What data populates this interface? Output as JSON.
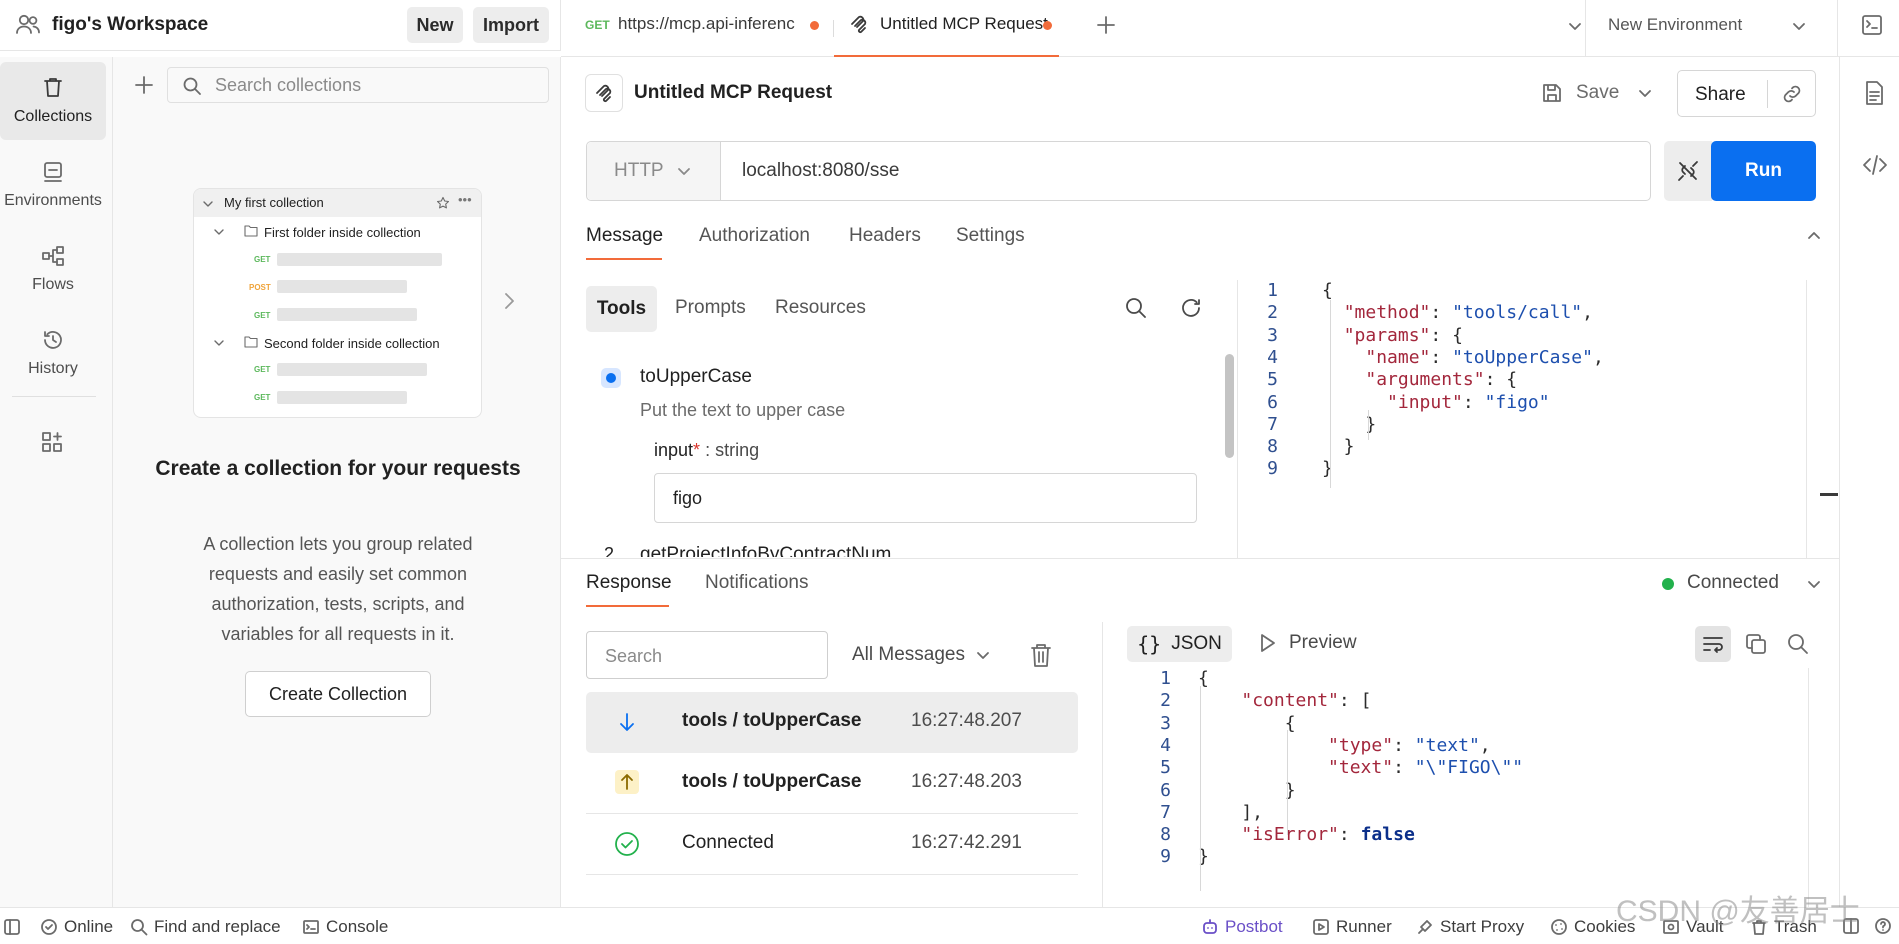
{
  "workspace": {
    "name": "figo's Workspace",
    "new_label": "New",
    "import_label": "Import"
  },
  "tabs": [
    {
      "method": "GET",
      "label": "https://mcp.api-inferenc"
    },
    {
      "label": "Untitled MCP Request"
    }
  ],
  "environment": {
    "selected": "New Environment"
  },
  "nav": {
    "items": [
      {
        "label": "Collections"
      },
      {
        "label": "Environments"
      },
      {
        "label": "Flows"
      },
      {
        "label": "History"
      }
    ]
  },
  "collections": {
    "search_placeholder": "Search collections",
    "preview": {
      "collection_name": "My first collection",
      "folder1": "First folder inside collection",
      "folder2": "Second folder inside collection",
      "methods": [
        "GET",
        "POST",
        "GET",
        "GET",
        "GET"
      ]
    },
    "empty_title": "Create a collection for your requests",
    "empty_desc": "A collection lets you group related requests and easily set common authorization, tests, scripts, and variables for all requests in it.",
    "create_button": "Create Collection"
  },
  "request": {
    "title": "Untitled MCP Request",
    "save_label": "Save",
    "share_label": "Share",
    "transport": "HTTP",
    "url": "localhost:8080/sse",
    "run_label": "Run",
    "tabs": [
      "Message",
      "Authorization",
      "Headers",
      "Settings"
    ],
    "tool_tabs": [
      "Tools",
      "Prompts",
      "Resources"
    ],
    "tools": [
      {
        "name": "toUpperCase",
        "description": "Put the text to upper case",
        "param_name": "input",
        "param_required": "*",
        "param_type": ": string",
        "param_value": "figo"
      },
      {
        "index": "2",
        "name": "getProjectInfoByContractNum"
      }
    ],
    "message_code": [
      {
        "n": "1",
        "segs": [
          {
            "t": "{",
            "c": "p"
          }
        ]
      },
      {
        "n": "2",
        "segs": [
          {
            "t": "  ",
            "c": "p"
          },
          {
            "t": "\"method\"",
            "c": "k"
          },
          {
            "t": ": ",
            "c": "p"
          },
          {
            "t": "\"tools/call\"",
            "c": "s"
          },
          {
            "t": ",",
            "c": "p"
          }
        ]
      },
      {
        "n": "3",
        "segs": [
          {
            "t": "  ",
            "c": "p"
          },
          {
            "t": "\"params\"",
            "c": "k"
          },
          {
            "t": ": {",
            "c": "p"
          }
        ]
      },
      {
        "n": "4",
        "segs": [
          {
            "t": "    ",
            "c": "p"
          },
          {
            "t": "\"name\"",
            "c": "k"
          },
          {
            "t": ": ",
            "c": "p"
          },
          {
            "t": "\"toUpperCase\"",
            "c": "s"
          },
          {
            "t": ",",
            "c": "p"
          }
        ]
      },
      {
        "n": "5",
        "segs": [
          {
            "t": "    ",
            "c": "p"
          },
          {
            "t": "\"arguments\"",
            "c": "k"
          },
          {
            "t": ": {",
            "c": "p"
          }
        ]
      },
      {
        "n": "6",
        "segs": [
          {
            "t": "      ",
            "c": "p"
          },
          {
            "t": "\"input\"",
            "c": "k"
          },
          {
            "t": ": ",
            "c": "p"
          },
          {
            "t": "\"figo\"",
            "c": "s"
          }
        ]
      },
      {
        "n": "7",
        "segs": [
          {
            "t": "    }",
            "c": "p"
          }
        ]
      },
      {
        "n": "8",
        "segs": [
          {
            "t": "  }",
            "c": "p"
          }
        ]
      },
      {
        "n": "9",
        "segs": [
          {
            "t": "}",
            "c": "p"
          }
        ]
      }
    ]
  },
  "response": {
    "tabs": [
      "Response",
      "Notifications"
    ],
    "status": "Connected",
    "search_placeholder": "Search",
    "filter": "All Messages",
    "messages": [
      {
        "icon": "arrow-down-icon",
        "label": "tools / toUpperCase",
        "time": "16:27:48.207"
      },
      {
        "icon": "arrow-up-icon",
        "label": "tools / toUpperCase",
        "time": "16:27:48.203"
      },
      {
        "icon": "check-circle-icon",
        "label": "Connected",
        "time": "16:27:42.291"
      }
    ],
    "view_json": "JSON",
    "view_preview": "Preview",
    "json_code": [
      {
        "n": "1",
        "segs": [
          {
            "t": "{",
            "c": "p"
          }
        ]
      },
      {
        "n": "2",
        "segs": [
          {
            "t": "    ",
            "c": "p"
          },
          {
            "t": "\"content\"",
            "c": "k"
          },
          {
            "t": ": [",
            "c": "p"
          }
        ]
      },
      {
        "n": "3",
        "segs": [
          {
            "t": "        {",
            "c": "p"
          }
        ]
      },
      {
        "n": "4",
        "segs": [
          {
            "t": "            ",
            "c": "p"
          },
          {
            "t": "\"type\"",
            "c": "k"
          },
          {
            "t": ": ",
            "c": "p"
          },
          {
            "t": "\"text\"",
            "c": "s"
          },
          {
            "t": ",",
            "c": "p"
          }
        ]
      },
      {
        "n": "5",
        "segs": [
          {
            "t": "            ",
            "c": "p"
          },
          {
            "t": "\"text\"",
            "c": "k"
          },
          {
            "t": ": ",
            "c": "p"
          },
          {
            "t": "\"\\\"FIGO\\\"\"",
            "c": "s"
          }
        ]
      },
      {
        "n": "6",
        "segs": [
          {
            "t": "        }",
            "c": "p"
          }
        ]
      },
      {
        "n": "7",
        "segs": [
          {
            "t": "    ],",
            "c": "p"
          }
        ]
      },
      {
        "n": "8",
        "segs": [
          {
            "t": "    ",
            "c": "p"
          },
          {
            "t": "\"isError\"",
            "c": "k"
          },
          {
            "t": ": ",
            "c": "p"
          },
          {
            "t": "false",
            "c": "b"
          }
        ]
      },
      {
        "n": "9",
        "segs": [
          {
            "t": "}",
            "c": "p"
          }
        ]
      }
    ]
  },
  "statusbar": {
    "online": "Online",
    "find_replace": "Find and replace",
    "console": "Console",
    "postbot": "Postbot",
    "runner": "Runner",
    "start_proxy": "Start Proxy",
    "cookies": "Cookies",
    "vault": "Vault",
    "trash": "Trash"
  },
  "watermark": "CSDN @友善居士",
  "colors": {
    "accent": "#f26b3a",
    "primary": "#0a6ff0",
    "connected": "#22b14c"
  }
}
